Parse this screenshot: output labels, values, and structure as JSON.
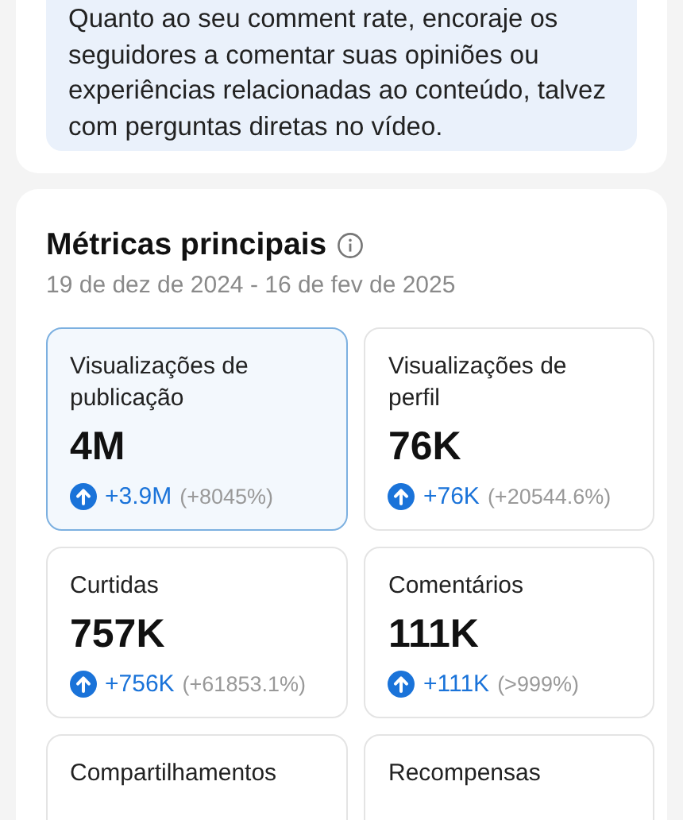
{
  "tip": {
    "text": "Quanto ao seu comment rate, encoraje os seguidores a comentar suas opiniões ou experiências relacionadas ao conteúdo, talvez com perguntas diretas no vídeo."
  },
  "metrics_section": {
    "title": "Métricas principais",
    "date_range": "19 de dez de 2024 - 16 de fev de 2025",
    "cards": [
      {
        "label": "Visualizações de publicação",
        "value": "4M",
        "change": "+3.9M",
        "percent": "(+8045%)",
        "selected": true
      },
      {
        "label": "Visualizações de perfil",
        "value": "76K",
        "change": "+76K",
        "percent": "(+20544.6%)",
        "selected": false
      },
      {
        "label": "Curtidas",
        "value": "757K",
        "change": "+756K",
        "percent": "(+61853.1%)",
        "selected": false
      },
      {
        "label": "Comentários",
        "value": "111K",
        "change": "+111K",
        "percent": "(>999%)",
        "selected": false
      },
      {
        "label": "Compartilhamentos",
        "selected": false
      },
      {
        "label": "Recompensas",
        "selected": false
      }
    ]
  }
}
